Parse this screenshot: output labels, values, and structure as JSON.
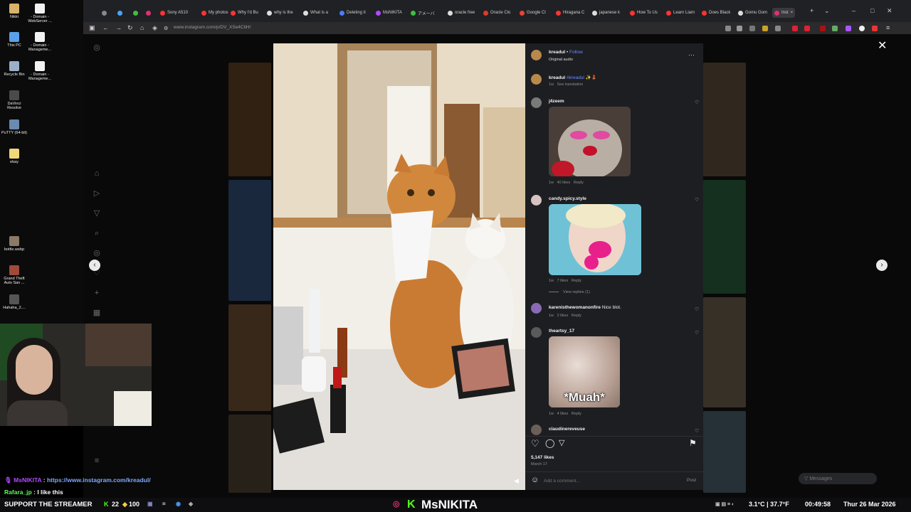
{
  "desktop": {
    "icons": [
      {
        "label": "Nikki",
        "color": "#d9b36a"
      },
      {
        "label": "- Domain - WebServer ...",
        "color": "#f2f2f2"
      },
      {
        "label": "This PC",
        "color": "#5aa0e8"
      },
      {
        "label": "- Domain - Manageme...",
        "color": "#f2f2f2"
      },
      {
        "label": "Recycle Bin",
        "color": "#9ab0c8"
      },
      {
        "label": "- Domain - Manageme...",
        "color": "#f2f2f2"
      },
      {
        "label": "DaVinci Resolve",
        "color": "#4a4a4a"
      },
      {
        "label": "PuTTY (64-bit)",
        "color": "#6a8ab0"
      },
      {
        "label": "ebay",
        "color": "#f0d77a"
      },
      {
        "label": "bottle.webp",
        "color": "#8a7a66"
      },
      {
        "label": "Grand Theft Auto San ...",
        "color": "#a04a3a"
      },
      {
        "label": "Hahaha_2....",
        "color": "#555555"
      }
    ]
  },
  "browser": {
    "tabs": [
      {
        "label": "",
        "color": "#888888"
      },
      {
        "label": "",
        "color": "#4aa3ff"
      },
      {
        "label": "",
        "color": "#3fbf3f"
      },
      {
        "label": "",
        "color": "#e1306c"
      },
      {
        "label": "Sony A510",
        "color": "#ff3333"
      },
      {
        "label": "My photos",
        "color": "#ff3333"
      },
      {
        "label": "Why I'd Bu",
        "color": "#ff3333"
      },
      {
        "label": "why is the",
        "color": "#dddddd"
      },
      {
        "label": "What is a",
        "color": "#dddddd"
      },
      {
        "label": "Deleting ti",
        "color": "#4a7cff"
      },
      {
        "label": "MsNIKITA",
        "color": "#b44aff"
      },
      {
        "label": "アメーバ",
        "color": "#3fbf3f"
      },
      {
        "label": "oracle free",
        "color": "#dddddd"
      },
      {
        "label": "Oracle Clo",
        "color": "#e03a2a"
      },
      {
        "label": "Google Cl",
        "color": "#ea4335"
      },
      {
        "label": "Hiragana C",
        "color": "#ff3333"
      },
      {
        "label": "japanese k",
        "color": "#dddddd"
      },
      {
        "label": "How To Us",
        "color": "#ff3333"
      },
      {
        "label": "Learn Liam",
        "color": "#ff3333"
      },
      {
        "label": "Does Black",
        "color": "#ff3333"
      },
      {
        "label": "Gomu Gom",
        "color": "#dddddd"
      },
      {
        "label": "Inst",
        "color": "#e1306c"
      }
    ],
    "url": "www.instagram.com/p/DV_XSe4CtiH/",
    "window_controls": {
      "new_tab": "+",
      "menu": "⌄",
      "minimize": "–",
      "maximize": "□",
      "close": "✕",
      "tab_close": "×"
    }
  },
  "post": {
    "author": "kreadul",
    "follow": "Follow",
    "audio": "Original audio",
    "caption_user": "kreadul",
    "caption_tag": "#kreadul",
    "caption_emoji": "✨💄",
    "caption_time": "1w",
    "see_translation": "See translation",
    "more_icon": "···",
    "comments": [
      {
        "user": "j4zeem",
        "text": "",
        "time": "1w",
        "likes": "40 likes",
        "reply": "Reply"
      },
      {
        "user": "candy.spicy.style",
        "text": "",
        "time": "1w",
        "likes": "7 likes",
        "reply": "Reply"
      },
      {
        "user": "karenisthewomanonfire",
        "text": "Nice blot.",
        "time": "1w",
        "likes": "2 likes",
        "reply": "Reply"
      },
      {
        "user": "theartsy_17",
        "text": "",
        "time": "1w",
        "likes": "4 likes",
        "reply": "Reply",
        "media_caption": "*Muah*"
      },
      {
        "user": "claudinereveuse",
        "text": ""
      }
    ],
    "view_replies": "View replies (1)",
    "like_count": "5,147 likes",
    "date": "March 17",
    "add_comment_placeholder": "Add a comment...",
    "post_button": "Post",
    "messages": "Messages"
  },
  "chat": [
    {
      "user": "MsNIKITA",
      "sep": " : ",
      "text": "https://www.instagram.com/kreadul/",
      "color": "#b44aff",
      "text_color": "#7fa8ff"
    },
    {
      "user": "Rafara_jp",
      "sep": " : ",
      "text": "I like this",
      "color": "#5cff5c",
      "text_color": "#ffffff"
    }
  ],
  "bottombar": {
    "support": "SUPPORT THE STREAMER",
    "kick_count": "22",
    "points": "100",
    "channel": "MsNIKITA",
    "weather": "3.1°C | 37.7°F",
    "time": "00:49:58",
    "date": "Thur 26 Mar 2026"
  },
  "colors": {
    "accent": "#e1306c",
    "kick": "#53fc18",
    "link": "#6b8cff"
  }
}
